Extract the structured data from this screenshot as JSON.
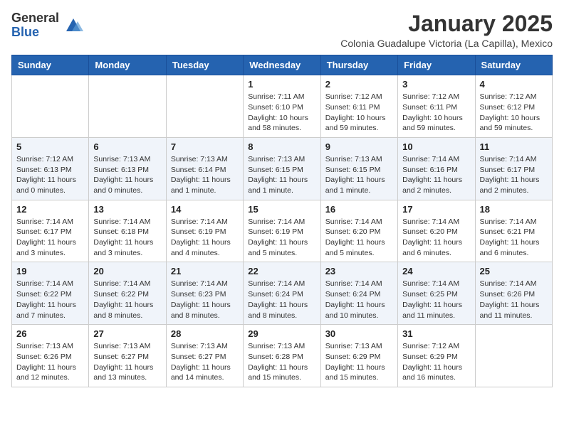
{
  "logo": {
    "general": "General",
    "blue": "Blue"
  },
  "header": {
    "month_title": "January 2025",
    "subtitle": "Colonia Guadalupe Victoria (La Capilla), Mexico"
  },
  "days_of_week": [
    "Sunday",
    "Monday",
    "Tuesday",
    "Wednesday",
    "Thursday",
    "Friday",
    "Saturday"
  ],
  "weeks": [
    [
      {
        "day": "",
        "info": ""
      },
      {
        "day": "",
        "info": ""
      },
      {
        "day": "",
        "info": ""
      },
      {
        "day": "1",
        "info": "Sunrise: 7:11 AM\nSunset: 6:10 PM\nDaylight: 10 hours\nand 58 minutes."
      },
      {
        "day": "2",
        "info": "Sunrise: 7:12 AM\nSunset: 6:11 PM\nDaylight: 10 hours\nand 59 minutes."
      },
      {
        "day": "3",
        "info": "Sunrise: 7:12 AM\nSunset: 6:11 PM\nDaylight: 10 hours\nand 59 minutes."
      },
      {
        "day": "4",
        "info": "Sunrise: 7:12 AM\nSunset: 6:12 PM\nDaylight: 10 hours\nand 59 minutes."
      }
    ],
    [
      {
        "day": "5",
        "info": "Sunrise: 7:12 AM\nSunset: 6:13 PM\nDaylight: 11 hours\nand 0 minutes."
      },
      {
        "day": "6",
        "info": "Sunrise: 7:13 AM\nSunset: 6:13 PM\nDaylight: 11 hours\nand 0 minutes."
      },
      {
        "day": "7",
        "info": "Sunrise: 7:13 AM\nSunset: 6:14 PM\nDaylight: 11 hours\nand 1 minute."
      },
      {
        "day": "8",
        "info": "Sunrise: 7:13 AM\nSunset: 6:15 PM\nDaylight: 11 hours\nand 1 minute."
      },
      {
        "day": "9",
        "info": "Sunrise: 7:13 AM\nSunset: 6:15 PM\nDaylight: 11 hours\nand 1 minute."
      },
      {
        "day": "10",
        "info": "Sunrise: 7:14 AM\nSunset: 6:16 PM\nDaylight: 11 hours\nand 2 minutes."
      },
      {
        "day": "11",
        "info": "Sunrise: 7:14 AM\nSunset: 6:17 PM\nDaylight: 11 hours\nand 2 minutes."
      }
    ],
    [
      {
        "day": "12",
        "info": "Sunrise: 7:14 AM\nSunset: 6:17 PM\nDaylight: 11 hours\nand 3 minutes."
      },
      {
        "day": "13",
        "info": "Sunrise: 7:14 AM\nSunset: 6:18 PM\nDaylight: 11 hours\nand 3 minutes."
      },
      {
        "day": "14",
        "info": "Sunrise: 7:14 AM\nSunset: 6:19 PM\nDaylight: 11 hours\nand 4 minutes."
      },
      {
        "day": "15",
        "info": "Sunrise: 7:14 AM\nSunset: 6:19 PM\nDaylight: 11 hours\nand 5 minutes."
      },
      {
        "day": "16",
        "info": "Sunrise: 7:14 AM\nSunset: 6:20 PM\nDaylight: 11 hours\nand 5 minutes."
      },
      {
        "day": "17",
        "info": "Sunrise: 7:14 AM\nSunset: 6:20 PM\nDaylight: 11 hours\nand 6 minutes."
      },
      {
        "day": "18",
        "info": "Sunrise: 7:14 AM\nSunset: 6:21 PM\nDaylight: 11 hours\nand 6 minutes."
      }
    ],
    [
      {
        "day": "19",
        "info": "Sunrise: 7:14 AM\nSunset: 6:22 PM\nDaylight: 11 hours\nand 7 minutes."
      },
      {
        "day": "20",
        "info": "Sunrise: 7:14 AM\nSunset: 6:22 PM\nDaylight: 11 hours\nand 8 minutes."
      },
      {
        "day": "21",
        "info": "Sunrise: 7:14 AM\nSunset: 6:23 PM\nDaylight: 11 hours\nand 8 minutes."
      },
      {
        "day": "22",
        "info": "Sunrise: 7:14 AM\nSunset: 6:24 PM\nDaylight: 11 hours\nand 8 minutes."
      },
      {
        "day": "23",
        "info": "Sunrise: 7:14 AM\nSunset: 6:24 PM\nDaylight: 11 hours\nand 10 minutes."
      },
      {
        "day": "24",
        "info": "Sunrise: 7:14 AM\nSunset: 6:25 PM\nDaylight: 11 hours\nand 11 minutes."
      },
      {
        "day": "25",
        "info": "Sunrise: 7:14 AM\nSunset: 6:26 PM\nDaylight: 11 hours\nand 11 minutes."
      }
    ],
    [
      {
        "day": "26",
        "info": "Sunrise: 7:13 AM\nSunset: 6:26 PM\nDaylight: 11 hours\nand 12 minutes."
      },
      {
        "day": "27",
        "info": "Sunrise: 7:13 AM\nSunset: 6:27 PM\nDaylight: 11 hours\nand 13 minutes."
      },
      {
        "day": "28",
        "info": "Sunrise: 7:13 AM\nSunset: 6:27 PM\nDaylight: 11 hours\nand 14 minutes."
      },
      {
        "day": "29",
        "info": "Sunrise: 7:13 AM\nSunset: 6:28 PM\nDaylight: 11 hours\nand 15 minutes."
      },
      {
        "day": "30",
        "info": "Sunrise: 7:13 AM\nSunset: 6:29 PM\nDaylight: 11 hours\nand 15 minutes."
      },
      {
        "day": "31",
        "info": "Sunrise: 7:12 AM\nSunset: 6:29 PM\nDaylight: 11 hours\nand 16 minutes."
      },
      {
        "day": "",
        "info": ""
      }
    ]
  ]
}
